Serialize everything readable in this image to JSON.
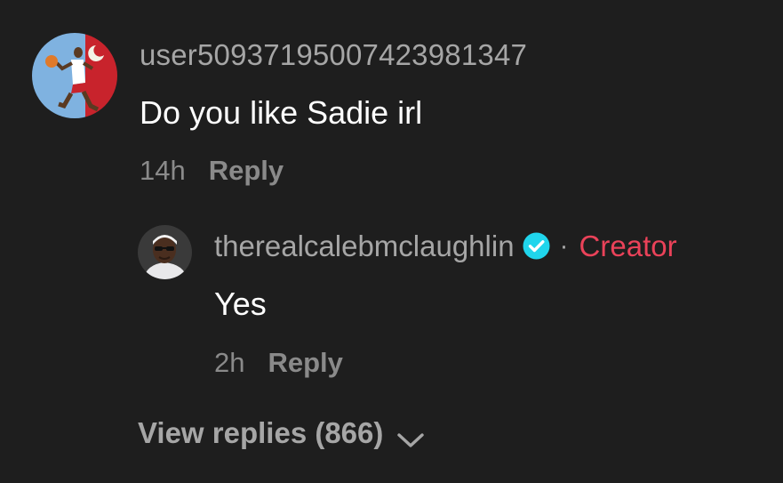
{
  "comment": {
    "username": "user5093719500742398134​7",
    "text": "Do you like Sadie irl",
    "time": "14h",
    "reply_label": "Reply",
    "avatar_icon": "basketball-player-avatar"
  },
  "reply": {
    "username": "therealcalebmclaughlin",
    "verified_icon": "verified-badge-icon",
    "separator": "·",
    "creator_label": "Creator",
    "text": "Yes",
    "time": "2h",
    "reply_label": "Reply",
    "avatar_icon": "person-sunglasses-avatar"
  },
  "view_replies": {
    "label": "View replies (866)",
    "icon": "chevron-down-icon"
  },
  "colors": {
    "background": "#1e1e1e",
    "username": "#a6a6a6",
    "meta": "#8a8a8a",
    "creator": "#ea4259",
    "verified": "#20d5ec"
  }
}
